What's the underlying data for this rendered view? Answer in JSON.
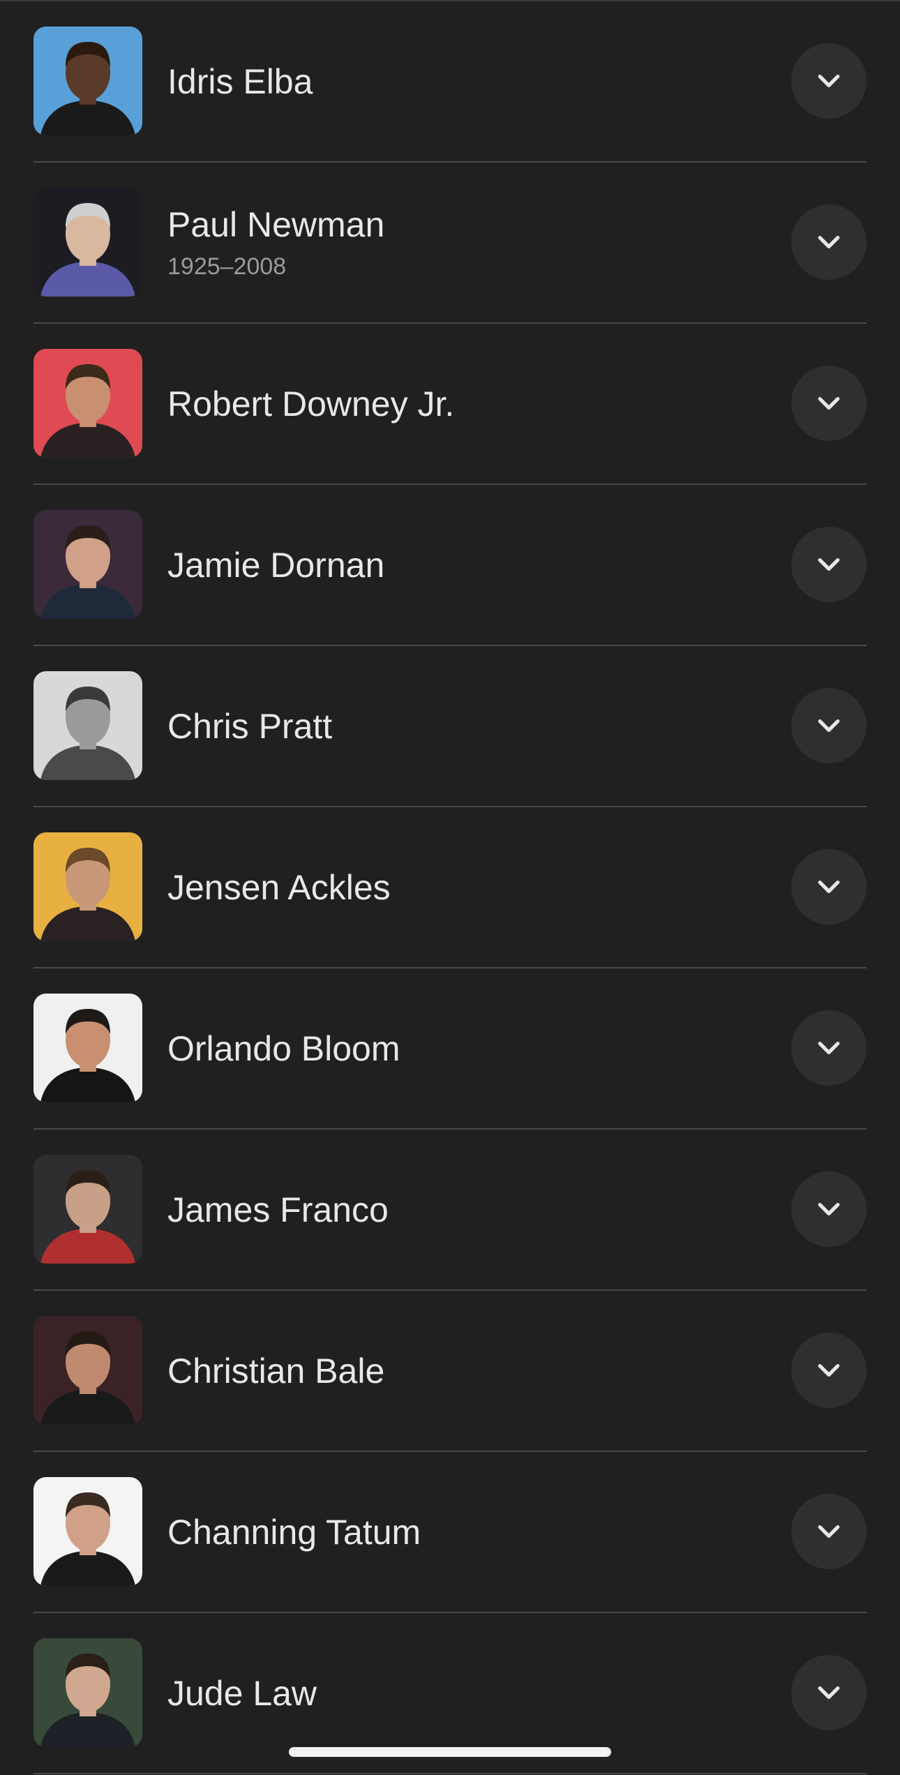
{
  "people": [
    {
      "name": "Idris Elba",
      "subtitle": "",
      "bg": "#5aa0d8",
      "skin": "#5a3a28",
      "hair": "#2a1a10",
      "suit": "#1a1a1a"
    },
    {
      "name": "Paul Newman",
      "subtitle": "1925–2008",
      "bg": "#1c1c22",
      "skin": "#d9b8a0",
      "hair": "#cfcfcf",
      "suit": "#5a5aa8"
    },
    {
      "name": "Robert Downey Jr.",
      "subtitle": "",
      "bg": "#e04a52",
      "skin": "#c89070",
      "hair": "#3a2a1a",
      "suit": "#2a2022"
    },
    {
      "name": "Jamie Dornan",
      "subtitle": "",
      "bg": "#3a2a3a",
      "skin": "#d0a088",
      "hair": "#2a1e18",
      "suit": "#1e2a3a"
    },
    {
      "name": "Chris Pratt",
      "subtitle": "",
      "bg": "#d8d8d8",
      "skin": "#9a9a9a",
      "hair": "#3a3a3a",
      "suit": "#4a4a4a"
    },
    {
      "name": "Jensen Ackles",
      "subtitle": "",
      "bg": "#e8b040",
      "skin": "#c89878",
      "hair": "#6a4a2a",
      "suit": "#2a2222"
    },
    {
      "name": "Orlando Bloom",
      "subtitle": "",
      "bg": "#f0f0f0",
      "skin": "#c89070",
      "hair": "#1e1a18",
      "suit": "#151515"
    },
    {
      "name": "James Franco",
      "subtitle": "",
      "bg": "#2e2e30",
      "skin": "#c8a088",
      "hair": "#2a2018",
      "suit": "#b03030"
    },
    {
      "name": "Christian Bale",
      "subtitle": "",
      "bg": "#3a2226",
      "skin": "#c08a70",
      "hair": "#241a14",
      "suit": "#1a1a1a"
    },
    {
      "name": "Channing Tatum",
      "subtitle": "",
      "bg": "#f4f4f4",
      "skin": "#d0a088",
      "hair": "#3a2a20",
      "suit": "#1a1a1a"
    },
    {
      "name": "Jude Law",
      "subtitle": "",
      "bg": "#3a4a3a",
      "skin": "#d0a890",
      "hair": "#2a2018",
      "suit": "#1e2228"
    }
  ],
  "colors": {
    "background": "#202021",
    "divider": "#4a4a4c",
    "button_bg": "#2f2f31",
    "chevron": "#e8e8ea"
  }
}
